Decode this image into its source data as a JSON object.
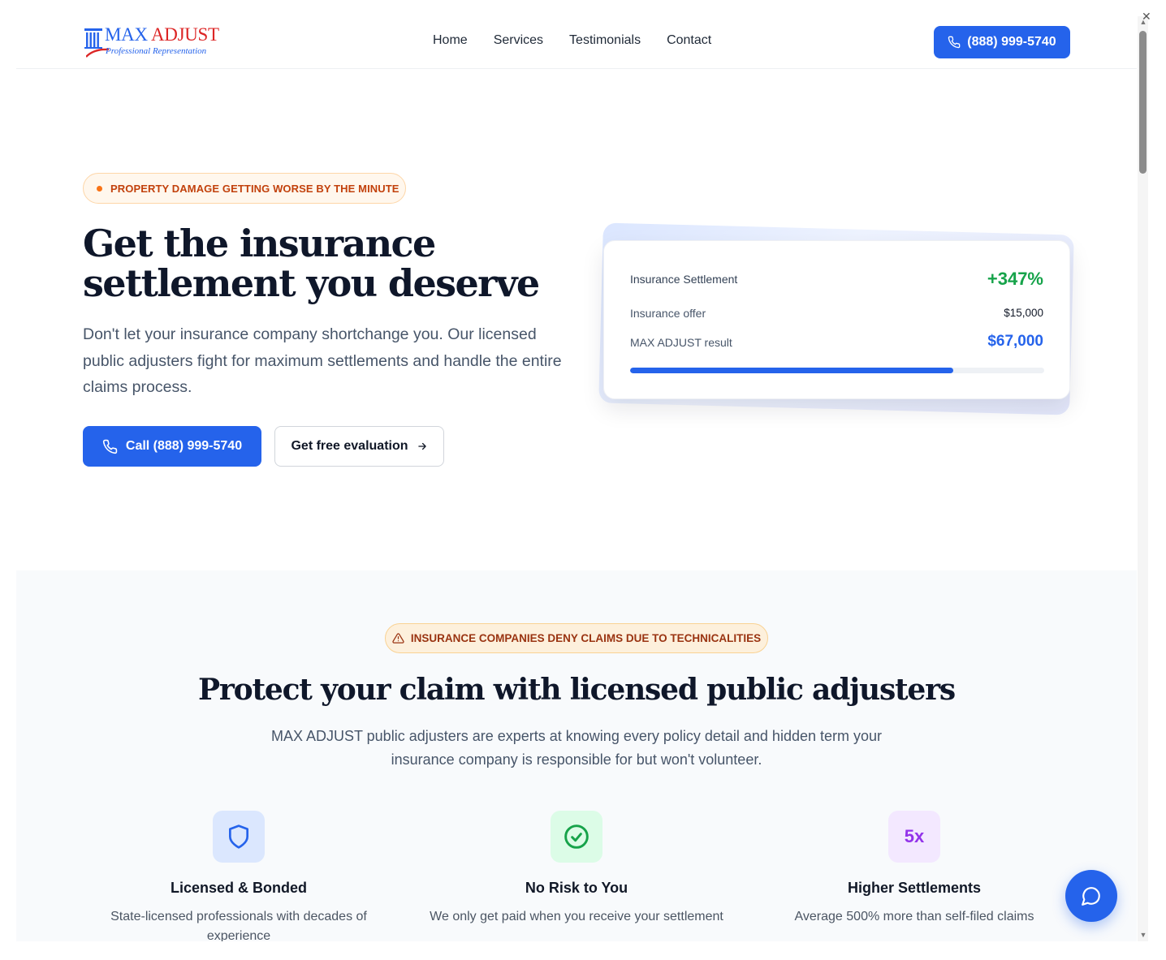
{
  "header": {
    "brand_max": "MAX",
    "brand_adjust": "ADJUST",
    "tagline": "Professional Representation",
    "nav": [
      "Home",
      "Services",
      "Testimonials",
      "Contact"
    ],
    "phone_label": "(888) 999-5740"
  },
  "hero": {
    "badge": "PROPERTY DAMAGE GETTING WORSE BY THE MINUTE",
    "title_line1": "Get the insurance",
    "title_line2": "settlement you deserve",
    "subtitle": "Don't let your insurance company shortchange you. Our licensed public adjusters fight for maximum settlements and handle the entire claims process.",
    "cta_call": "Call (888) 999-5740",
    "cta_eval": "Get free evaluation"
  },
  "settlement_card": {
    "heading": "Insurance Settlement",
    "increase": "+347%",
    "offer_label": "Insurance offer",
    "offer_value": "$15,000",
    "result_label": "MAX ADJUST result",
    "result_value": "$67,000",
    "progress_fraction": 0.78
  },
  "section2": {
    "badge": "INSURANCE COMPANIES DENY CLAIMS DUE TO TECHNICALITIES",
    "title": "Protect your claim with licensed public adjusters",
    "subtitle": "MAX ADJUST public adjusters are experts at knowing every policy detail and hidden term your insurance company is responsible for but won't volunteer.",
    "features": [
      {
        "icon": "shield-icon",
        "title": "Licensed & Bonded",
        "desc": "State-licensed professionals with decades of experience"
      },
      {
        "icon": "check-circle-icon",
        "title": "No Risk to You",
        "desc": "We only get paid when you receive your settlement"
      },
      {
        "icon_text": "5x",
        "title": "Higher Settlements",
        "desc": "Average 500% more than self-filed claims"
      }
    ]
  },
  "colors": {
    "primary": "#2563eb",
    "success": "#16a34a",
    "warning": "#c2410c",
    "brand_red": "#dc2626"
  }
}
